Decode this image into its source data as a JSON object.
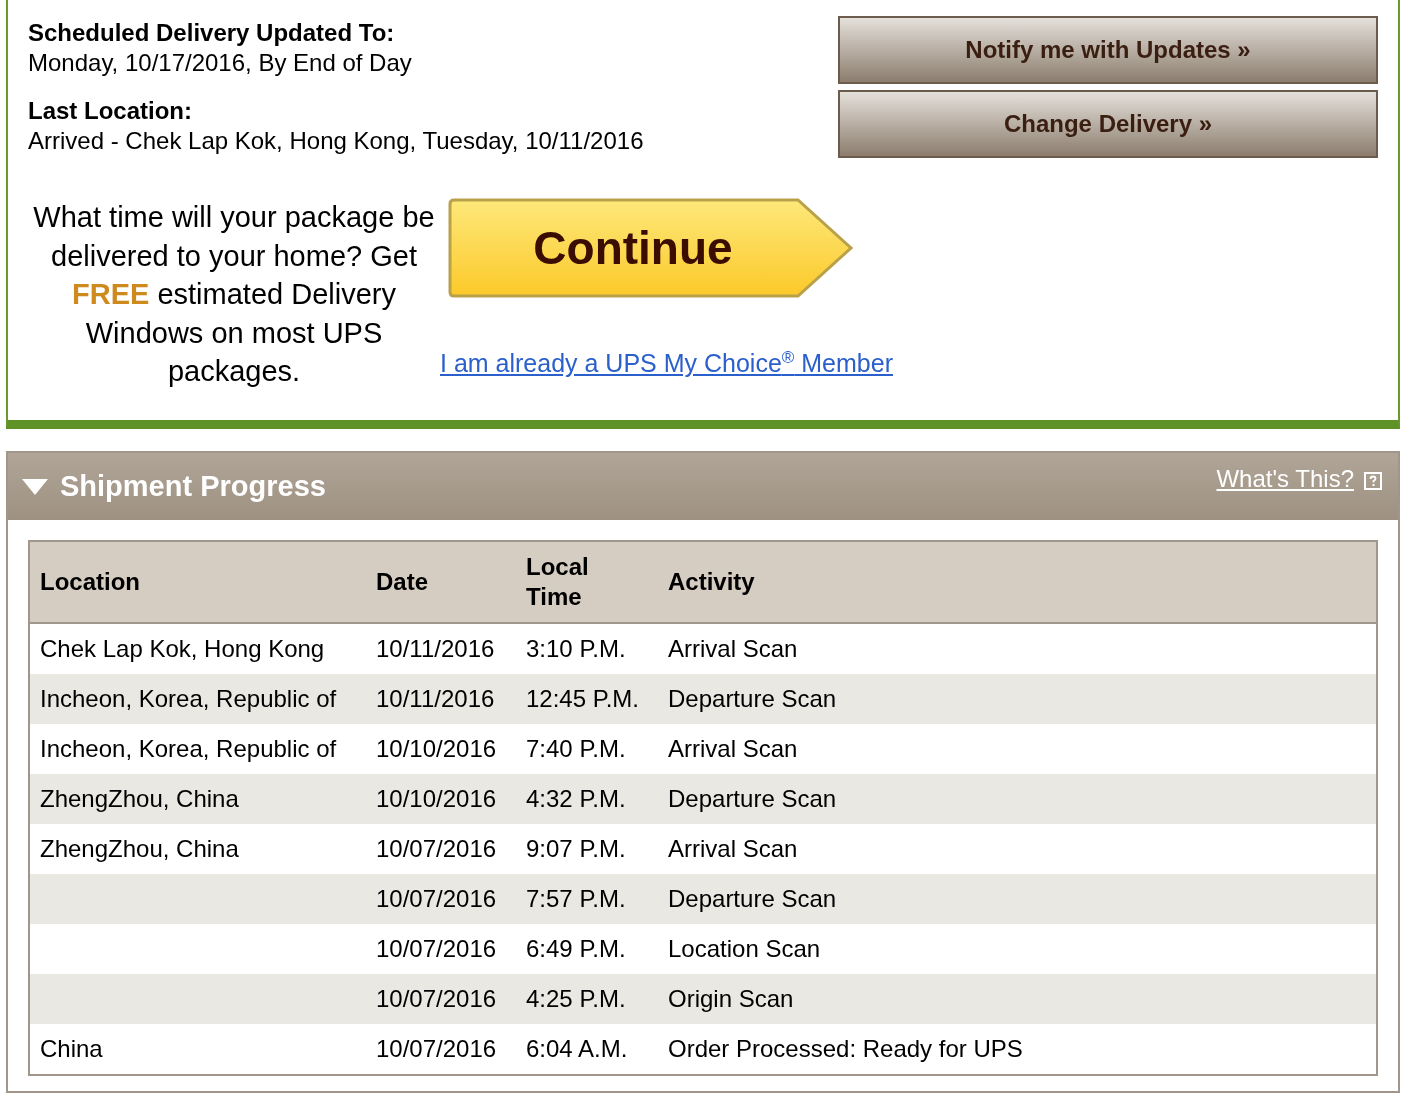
{
  "delivery": {
    "scheduled_label": "Scheduled Delivery Updated To:",
    "scheduled_value": "Monday, 10/17/2016, By End of Day",
    "last_location_label": "Last Location:",
    "last_location_value": "Arrived - Chek Lap Kok, Hong Kong, Tuesday, 10/11/2016"
  },
  "actions": [
    "Notify me with Updates »",
    "Change Delivery »"
  ],
  "promo": {
    "text": "What time will your package be delivered to your home? Get **FREE** estimated Delivery Windows on most UPS packages.",
    "button": "Continue",
    "link": "I am already a UPS My Choice$^{®}$ Member"
  },
  "progress": {
    "title": "Shipment Progress",
    "expanded": true,
    "help_link": "What's This?",
    "columns": [
      "Location",
      "Date",
      "Local Time",
      "Activity"
    ],
    "rows": [
      {
        "location": "Chek Lap Kok, Hong Kong",
        "date": "10/11/2016",
        "time": "3:10 P.M.",
        "activity": "Arrival Scan"
      },
      {
        "location": "Incheon, Korea, Republic of",
        "date": "10/11/2016",
        "time": "12:45 P.M.",
        "activity": "Departure Scan"
      },
      {
        "location": "Incheon, Korea, Republic of",
        "date": "10/10/2016",
        "time": "7:40 P.M.",
        "activity": "Arrival Scan"
      },
      {
        "location": "ZhengZhou, China",
        "date": "10/10/2016",
        "time": "4:32 P.M.",
        "activity": "Departure Scan"
      },
      {
        "location": "ZhengZhou, China",
        "date": "10/07/2016",
        "time": "9:07 P.M.",
        "activity": "Arrival Scan"
      },
      {
        "date": "10/07/2016",
        "time": "7:57 P.M.",
        "activity": "Departure Scan"
      },
      {
        "date": "10/07/2016",
        "time": "6:49 P.M.",
        "activity": "Location Scan"
      },
      {
        "date": "10/07/2016",
        "time": "4:25 P.M.",
        "activity": "Origin Scan"
      },
      {
        "location": "China",
        "date": "10/07/2016",
        "time": "6:04 A.M.",
        "activity": "Order Processed: Ready for UPS"
      }
    ]
  }
}
